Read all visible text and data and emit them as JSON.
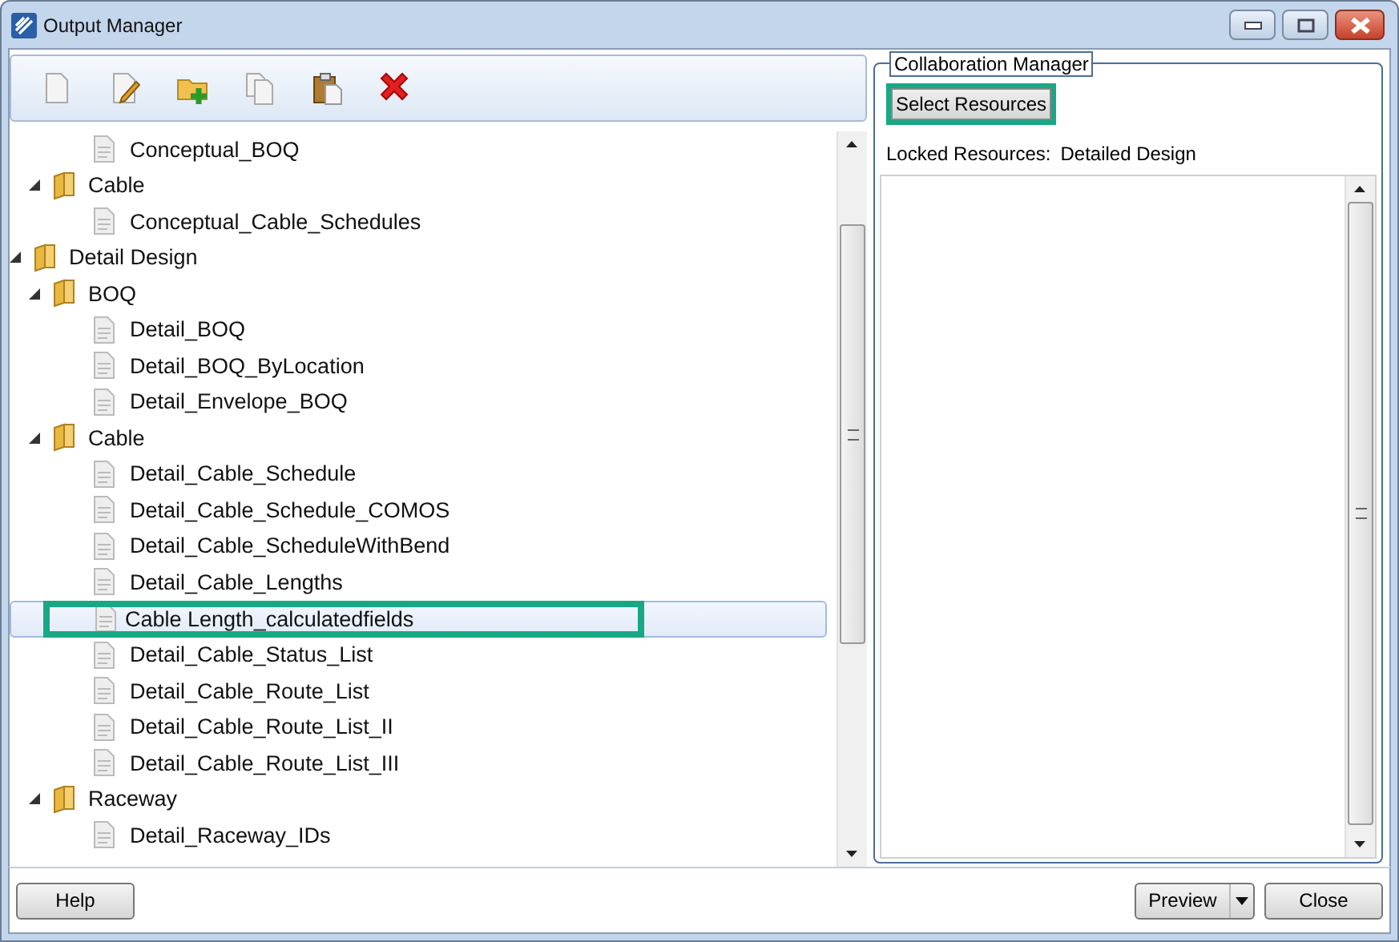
{
  "window": {
    "title": "Output Manager"
  },
  "toolbar": [
    {
      "kind": "new"
    },
    {
      "kind": "edit"
    },
    {
      "kind": "add-folder"
    },
    {
      "kind": "copy"
    },
    {
      "kind": "paste"
    },
    {
      "kind": "delete"
    }
  ],
  "tree": {
    "items": [
      {
        "children": [
          {
            "children": [
              {
                "kind": "report",
                "label": "Conceptual_BOQ",
                "selected": false,
                "highlighted": false
              }
            ]
          },
          {
            "kind": "folder",
            "label": "Cable",
            "expanded": true,
            "children": [
              {
                "kind": "report",
                "label": "Conceptual_Cable_Schedules",
                "selected": false,
                "highlighted": false
              }
            ]
          }
        ]
      },
      {
        "kind": "folder",
        "label": "Detail Design",
        "expanded": true,
        "children": [
          {
            "kind": "folder",
            "label": "BOQ",
            "expanded": true,
            "children": [
              {
                "kind": "report",
                "label": "Detail_BOQ",
                "selected": false,
                "highlighted": false
              },
              {
                "kind": "report",
                "label": "Detail_BOQ_ByLocation",
                "selected": false,
                "highlighted": false
              },
              {
                "kind": "report",
                "label": "Detail_Envelope_BOQ",
                "selected": false,
                "highlighted": false
              }
            ]
          },
          {
            "kind": "folder",
            "label": "Cable",
            "expanded": true,
            "children": [
              {
                "kind": "report",
                "label": "Detail_Cable_Schedule",
                "selected": false,
                "highlighted": false
              },
              {
                "kind": "report",
                "label": "Detail_Cable_Schedule_COMOS",
                "selected": false,
                "highlighted": false
              },
              {
                "kind": "report",
                "label": "Detail_Cable_ScheduleWithBend",
                "selected": false,
                "highlighted": false
              },
              {
                "kind": "report",
                "label": "Detail_Cable_Lengths",
                "selected": false,
                "highlighted": false
              },
              {
                "kind": "report",
                "label": "Cable Length_calculatedfields",
                "selected": true,
                "highlighted": true
              },
              {
                "kind": "report",
                "label": "Detail_Cable_Status_List",
                "selected": false,
                "highlighted": false
              },
              {
                "kind": "report",
                "label": "Detail_Cable_Route_List",
                "selected": false,
                "highlighted": false
              },
              {
                "kind": "report",
                "label": "Detail_Cable_Route_List_II",
                "selected": false,
                "highlighted": false
              },
              {
                "kind": "report",
                "label": "Detail_Cable_Route_List_III",
                "selected": false,
                "highlighted": false
              }
            ]
          },
          {
            "kind": "folder",
            "label": "Raceway",
            "expanded": true,
            "children": [
              {
                "kind": "report",
                "label": "Detail_Raceway_IDs",
                "selected": false,
                "highlighted": false
              }
            ]
          }
        ]
      }
    ]
  },
  "collaboration": {
    "title": "Collaboration Manager",
    "select_button": {
      "label": "Select Resources",
      "highlighted": true
    },
    "locked_label": "Locked Resources:",
    "locked_value": "Detailed Design"
  },
  "footer": {
    "help": "Help",
    "preview": "Preview",
    "close": "Close"
  }
}
